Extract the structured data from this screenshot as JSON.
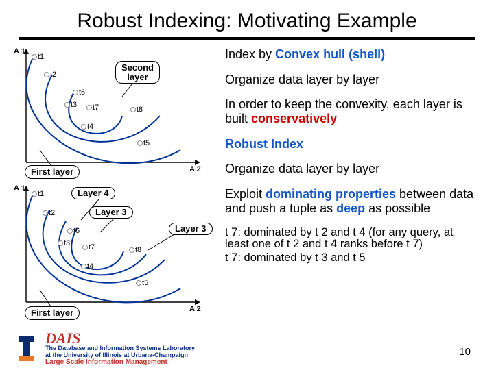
{
  "title": "Robust Indexing: Motivating Example",
  "diagram_common": {
    "axis1": "A 1",
    "axis2": "A 2",
    "points": {
      "t1": "t1",
      "t2": "t2",
      "t3": "t3",
      "t4": "t4",
      "t5": "t5",
      "t6": "t6",
      "t7": "t7",
      "t8": "t8"
    },
    "first_layer": "First layer"
  },
  "diagram_top": {
    "second_layer_line1": "Second",
    "second_layer_line2": "layer"
  },
  "diagram_bottom": {
    "layer4": "Layer 4",
    "layer3": "Layer 3",
    "layer3b": "Layer 3"
  },
  "bullets": {
    "b1a": "Index by ",
    "b1b": "Convex hull (shell)",
    "b2": "Organize data layer by layer",
    "b3a": "In order to keep the convexity, each layer is built ",
    "b3b": "conservatively",
    "b4": "Robust Index",
    "b5": "Organize data layer by layer",
    "b6a": "Exploit ",
    "b6b": "dominating properties",
    "b6c": " between data and push a tuple as ",
    "b6d": "deep",
    "b6e": " as possible"
  },
  "notes": {
    "n1": "t 7: dominated by t 2 and t 4 (for any query, at least one of t 2 and t 4 ranks before t 7)",
    "n2": "t 7: dominated by t 3 and t 5"
  },
  "footer": {
    "dais": "DAIS",
    "lab1": "The Database and Information Systems Laboratory",
    "lab2": "at the University of Illinois at Urbana-Champaign",
    "lab3": "Large Scale Information Management"
  },
  "pagenum": "10"
}
